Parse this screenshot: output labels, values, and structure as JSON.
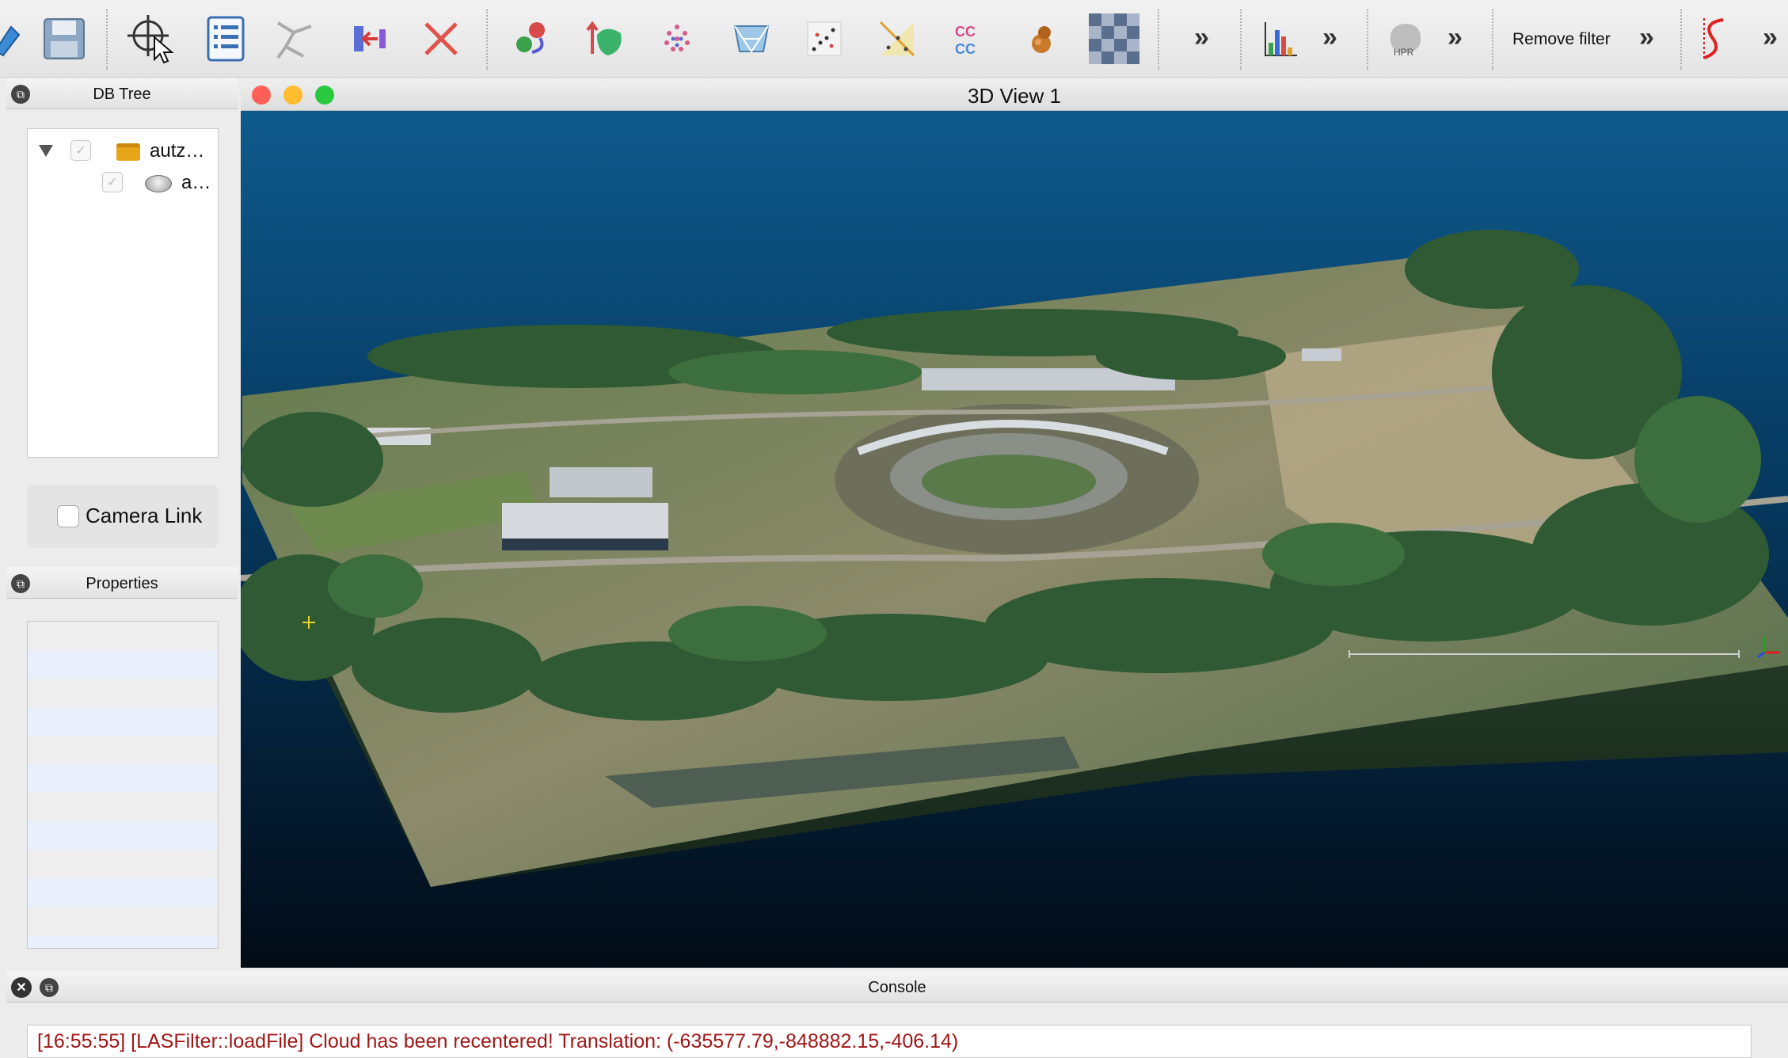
{
  "toolbar": {
    "icons": [
      "save-icon",
      "picking-icon",
      "list-icon",
      "graph-icon",
      "back-arrow-icon",
      "delete-icon",
      "sphere-icon",
      "normals-icon",
      "dots-icon",
      "mesh-icon",
      "scatter-icon",
      "triangle-icon",
      "cc-icon",
      "mushroom-icon",
      "checker-icon",
      "histogram-icon",
      "hpr-icon",
      "curve-icon"
    ],
    "hpr_label": "HPR",
    "remove_filter_label": "Remove filter",
    "cc_label": "CC"
  },
  "db_tree": {
    "title": "DB Tree",
    "items": [
      {
        "label": "autz…",
        "icon": "folder-icon"
      },
      {
        "label": "a…",
        "icon": "cloud-icon"
      }
    ]
  },
  "camera_link": {
    "label": "Camera Link",
    "checked": false
  },
  "properties": {
    "title": "Properties"
  },
  "view": {
    "title": "3D View 1",
    "traffic_colors": [
      "#fe5f57",
      "#febc2e",
      "#28c840"
    ]
  },
  "console": {
    "title": "Console",
    "lines": [
      "[16:55:55] [LASFilter::loadFile] Cloud has been recentered! Translation: (-635577.79,-848882.15,-406.14)"
    ]
  },
  "colors": {
    "sky_top": "#0e5a8c",
    "sky_bottom": "#020b16",
    "console_text": "#a11616"
  }
}
